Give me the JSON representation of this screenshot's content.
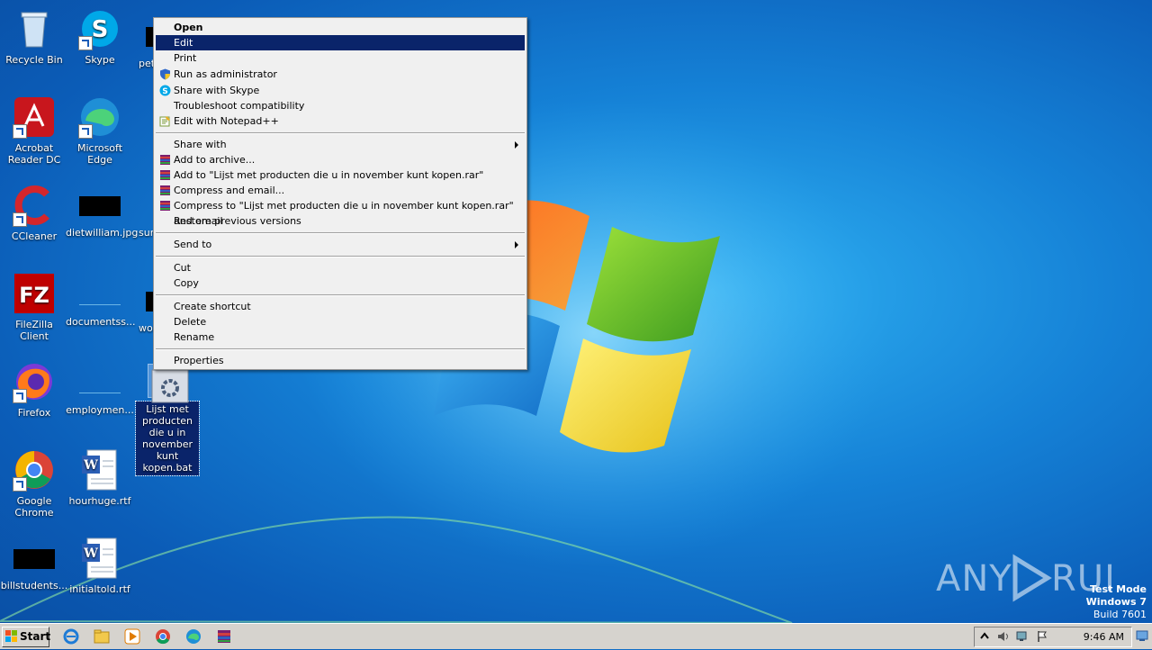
{
  "desktop": {
    "icons": [
      {
        "label": "Recycle Bin"
      },
      {
        "label": "Skype"
      },
      {
        "label": "pet"
      },
      {
        "label": "Acrobat Reader DC"
      },
      {
        "label": "Microsoft Edge"
      },
      {
        "label": "CCleaner"
      },
      {
        "label": "dietwilliam.jpg"
      },
      {
        "label": "sur"
      },
      {
        "label": "FileZilla Client"
      },
      {
        "label": "documentss..."
      },
      {
        "label": "wor"
      },
      {
        "label": "Firefox"
      },
      {
        "label": "employmen..."
      },
      {
        "label": "Lijst met producten die u in november kunt kopen.bat"
      },
      {
        "label": "Google Chrome"
      },
      {
        "label": "hourhuge.rtf"
      },
      {
        "label": "billstudents..."
      },
      {
        "label": "initialtold.rtf"
      }
    ]
  },
  "context_menu": {
    "items": [
      {
        "label": "Open",
        "icon": ""
      },
      {
        "label": "Edit",
        "icon": ""
      },
      {
        "label": "Print",
        "icon": ""
      },
      {
        "label": "Run as administrator",
        "icon": "shield-icon"
      },
      {
        "label": "Share with Skype",
        "icon": "skype-icon"
      },
      {
        "label": "Troubleshoot compatibility",
        "icon": ""
      },
      {
        "label": "Edit with Notepad++",
        "icon": "notepadpp-icon"
      },
      {
        "label": "Share with",
        "icon": ""
      },
      {
        "label": "Add to archive...",
        "icon": "winrar-icon"
      },
      {
        "label": "Add to \"Lijst met producten die u in november kunt kopen.rar\"",
        "icon": "winrar-icon"
      },
      {
        "label": "Compress and email...",
        "icon": "winrar-icon"
      },
      {
        "label": "Compress to \"Lijst met producten die u in november kunt kopen.rar\" and email",
        "icon": "winrar-icon"
      },
      {
        "label": "Restore previous versions",
        "icon": ""
      },
      {
        "label": "Send to",
        "icon": ""
      },
      {
        "label": "Cut",
        "icon": ""
      },
      {
        "label": "Copy",
        "icon": ""
      },
      {
        "label": "Create shortcut",
        "icon": ""
      },
      {
        "label": "Delete",
        "icon": ""
      },
      {
        "label": "Rename",
        "icon": ""
      },
      {
        "label": "Properties",
        "icon": ""
      }
    ],
    "highlighted": "Edit"
  },
  "taskbar": {
    "start_label": "Start",
    "clock": "9:46 AM",
    "quick_launch": [
      "ie-icon",
      "explorer-icon",
      "media-player-icon",
      "chrome-icon",
      "edge-icon",
      "winrar-icon"
    ]
  },
  "watermark": {
    "line1": "Test Mode",
    "line2": "Windows 7",
    "line3": "Build 7601"
  },
  "brand": {
    "text": "ANY RUN"
  },
  "colors": {
    "menu_highlight": "#0a246a",
    "desktop_blue": "#1581d6"
  }
}
